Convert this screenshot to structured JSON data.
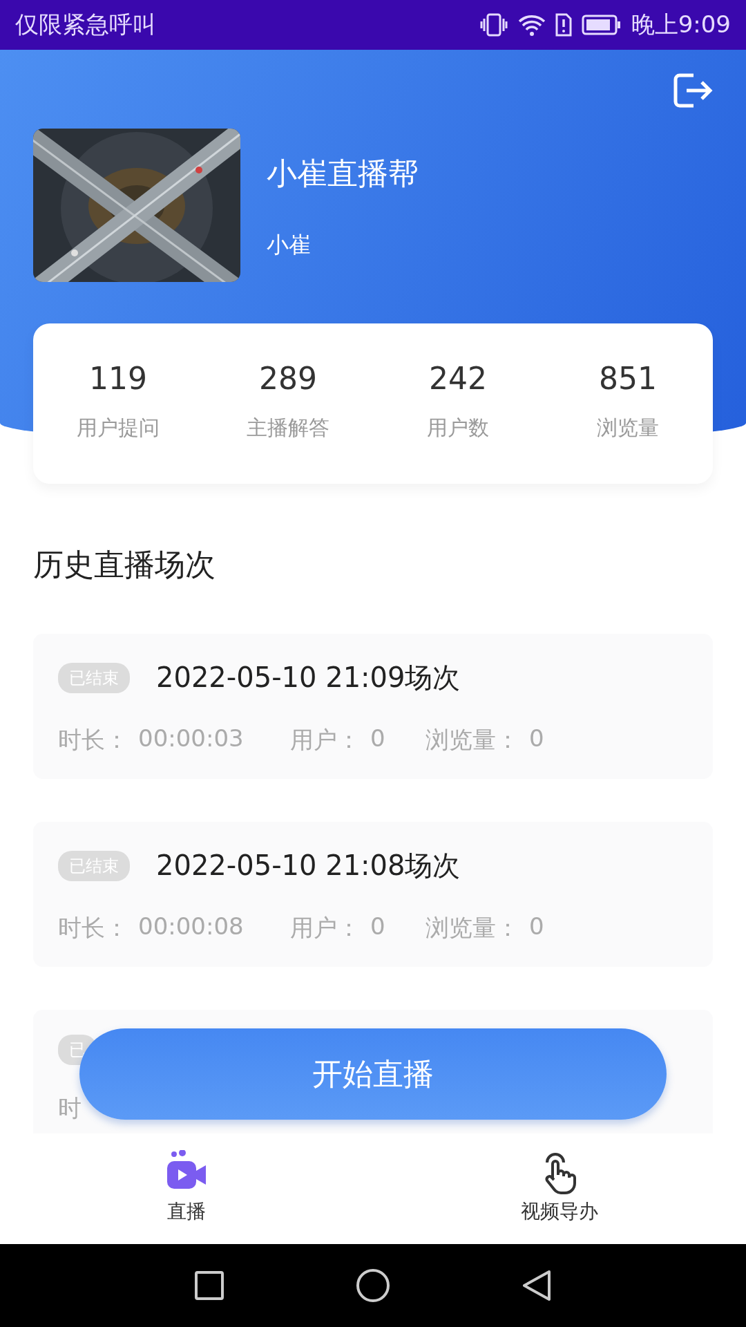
{
  "status_bar": {
    "carrier": "仅限紧急呼叫",
    "time": "晚上9:09"
  },
  "profile": {
    "title": "小崔直播帮",
    "name": "小崔"
  },
  "stats": [
    {
      "value": "119",
      "label": "用户提问"
    },
    {
      "value": "289",
      "label": "主播解答"
    },
    {
      "value": "242",
      "label": "用户数"
    },
    {
      "value": "851",
      "label": "浏览量"
    }
  ],
  "history": {
    "title": "历史直播场次",
    "sessions": [
      {
        "badge": "已结束",
        "title": "2022-05-10 21:09场次",
        "duration_label": "时长：",
        "duration": "00:00:03",
        "users_label": "用户：",
        "users": "0",
        "views_label": "浏览量：",
        "views": "0"
      },
      {
        "badge": "已结束",
        "title": "2022-05-10 21:08场次",
        "duration_label": "时长：",
        "duration": "00:00:08",
        "users_label": "用户：",
        "users": "0",
        "views_label": "浏览量：",
        "views": "0"
      },
      {
        "badge": "已",
        "duration_label": "时"
      }
    ]
  },
  "start_button": "开始直播",
  "tabs": [
    {
      "label": "直播",
      "kind": "live",
      "selected": true
    },
    {
      "label": "视频导办",
      "kind": "guide",
      "selected": false
    }
  ]
}
